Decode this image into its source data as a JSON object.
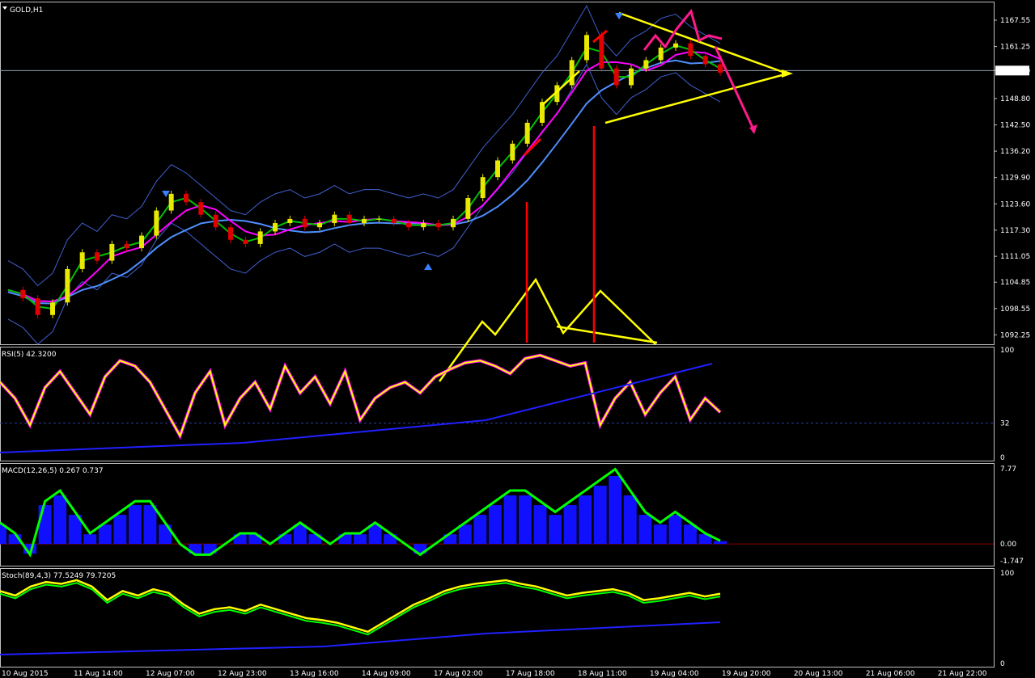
{
  "chart_title": "GOLD,H1",
  "price_tag": "1155.50",
  "colors": {
    "background": "#000000",
    "grid": "#2c2c2c",
    "panel_border": "#c0c0c0",
    "bull_candle": "#e8e800",
    "bear_candle": "#e00000",
    "ma_fast": "#00c000",
    "ma_mid": "#ff00ff",
    "ma_slow": "#4f8fff",
    "bands": "#4060d0",
    "annotation_yellow": "#ffff00",
    "annotation_red": "#ff0000",
    "annotation_magenta": "#ff1a8c",
    "rsi_line": "#ffff00",
    "macd_hist": "#1010ff",
    "macd_line": "#00ff00"
  },
  "chart_data": [
    {
      "panel": "price",
      "type": "line",
      "title": "GOLD,H1",
      "y_ticks": [
        "1167.55",
        "1161.25",
        "1155.50",
        "1148.80",
        "1142.50",
        "1136.20",
        "1129.90",
        "1123.60",
        "1117.30",
        "1111.05",
        "1104.85",
        "1098.55",
        "1092.25"
      ],
      "ylim": [
        1090,
        1172
      ],
      "x_ticks": [
        "10 Aug 2015",
        "11 Aug 14:00",
        "12 Aug 07:00",
        "12 Aug 23:00",
        "13 Aug 16:00",
        "14 Aug 09:00",
        "17 Aug 02:00",
        "17 Aug 18:00",
        "18 Aug 11:00",
        "19 Aug 04:00",
        "19 Aug 20:00",
        "20 Aug 13:00",
        "21 Aug 06:00",
        "21 Aug 22:00"
      ],
      "series": [
        {
          "values": [
            1103,
            1101,
            1097,
            1100,
            1108,
            1112,
            1110,
            1114,
            1113,
            1116,
            1122,
            1126,
            1124,
            1121,
            1118,
            1115,
            1114,
            1117,
            1119,
            1120,
            1118,
            1119,
            1121,
            1119,
            1120,
            1120,
            1119,
            1118,
            1119,
            1118,
            1120,
            1125,
            1130,
            1134,
            1138,
            1143,
            1148,
            1152,
            1158,
            1164,
            1156,
            1152,
            1156,
            1158,
            1161,
            1162,
            1159,
            1157,
            1155
          ]
        }
      ],
      "current_price": 1155.5
    },
    {
      "panel": "rsi",
      "type": "line",
      "title": "RSI(5) 42.3200",
      "y_ticks": [
        "100",
        "32",
        "0"
      ],
      "ylim": [
        0,
        100
      ],
      "series": [
        {
          "values": [
            70,
            55,
            30,
            65,
            80,
            60,
            40,
            75,
            90,
            85,
            70,
            45,
            20,
            60,
            80,
            30,
            55,
            70,
            45,
            85,
            60,
            75,
            50,
            80,
            35,
            55,
            65,
            70,
            60,
            75,
            82,
            88,
            90,
            85,
            78,
            92,
            95,
            90,
            85,
            88,
            30,
            55,
            70,
            40,
            60,
            75,
            35,
            55,
            42
          ]
        }
      ]
    },
    {
      "panel": "macd",
      "type": "bar",
      "title": "MACD(12,26,5) 0.267 0.737",
      "y_ticks": [
        "7.77",
        "0.00",
        "-1.747"
      ],
      "ylim": [
        -1.9,
        8
      ],
      "series": [
        {
          "values": [
            2,
            1,
            -1,
            4,
            5,
            3,
            1,
            2,
            3,
            4,
            4,
            2,
            0,
            -1,
            -1,
            0,
            1,
            1,
            0,
            1,
            2,
            1,
            0,
            1,
            1,
            2,
            1,
            0,
            -1,
            0,
            1,
            2,
            3,
            4,
            5,
            5,
            4,
            3,
            4,
            5,
            6,
            7,
            5,
            3,
            2,
            3,
            2,
            1,
            0.3
          ]
        }
      ]
    },
    {
      "panel": "stoch",
      "type": "line",
      "title": "Stoch(89,4,3) 77.5249 79.7205",
      "y_ticks": [
        "100",
        "0"
      ],
      "ylim": [
        0,
        100
      ],
      "series": [
        {
          "values": [
            80,
            75,
            85,
            90,
            88,
            92,
            85,
            70,
            80,
            75,
            82,
            78,
            65,
            55,
            60,
            62,
            58,
            65,
            60,
            55,
            50,
            48,
            45,
            40,
            35,
            45,
            55,
            65,
            72,
            80,
            85,
            88,
            90,
            92,
            88,
            85,
            80,
            75,
            78,
            80,
            82,
            78,
            70,
            72,
            75,
            78,
            74,
            77
          ]
        }
      ]
    }
  ]
}
